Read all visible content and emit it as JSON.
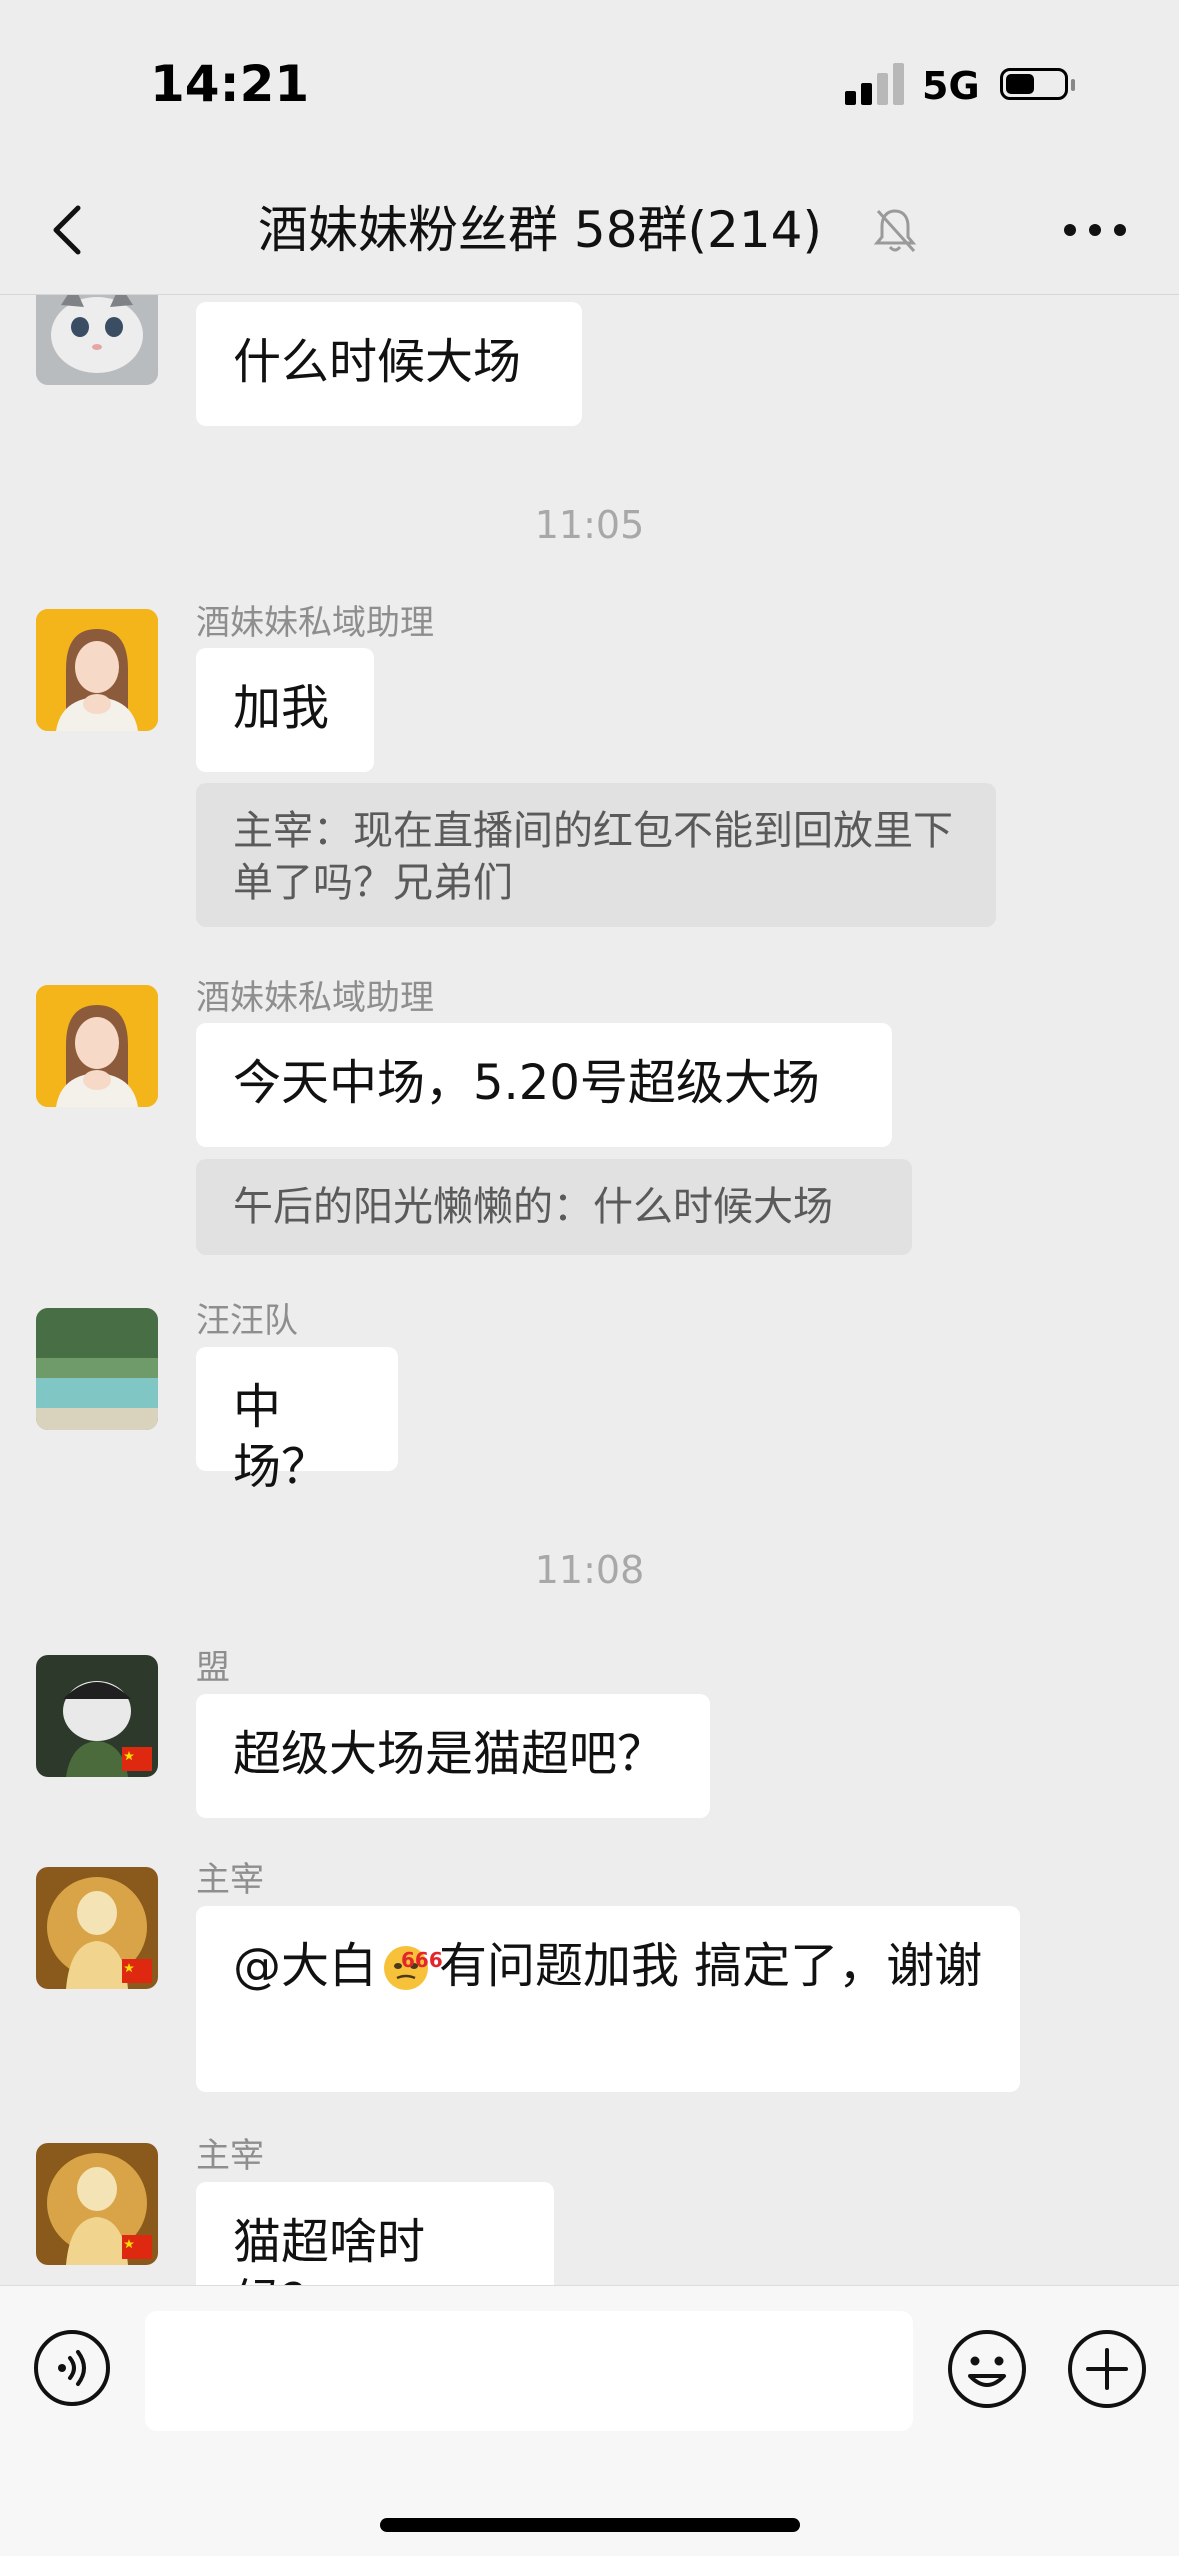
{
  "status_bar": {
    "time": "14:21",
    "network": "5G"
  },
  "nav": {
    "title": "酒妹妹粉丝群 58群(214)",
    "back_icon": "chevron-left-icon",
    "mute_icon": "bell-off-icon",
    "more_icon": "more-dots-icon"
  },
  "chat": {
    "msg0": {
      "text": "什么时候大场"
    },
    "time1": "11:05",
    "msg1": {
      "sender": "酒妹妹私域助理",
      "text": "加我",
      "quote": "主宰：现在直播间的红包不能到回放里下单了吗？兄弟们"
    },
    "msg2": {
      "sender": "酒妹妹私域助理",
      "text": "今天中场，5.20号超级大场",
      "quote": "午后的阳光懒懒的：什么时候大场"
    },
    "msg3": {
      "sender": "汪汪队",
      "text": "中场？"
    },
    "time2": "11:08",
    "msg4": {
      "sender": "盟",
      "text": "超级大场是猫超吧？"
    },
    "msg5": {
      "sender": "主宰",
      "mention": "@大白",
      "emoji_badge": "666",
      "text": "有问题加我 搞定了，谢谢"
    },
    "msg6": {
      "sender": "主宰",
      "text": "猫超啥时候？"
    }
  },
  "input_bar": {
    "value": "",
    "placeholder": "",
    "voice_icon": "voice-icon",
    "emoji_icon": "emoji-icon",
    "plus_icon": "plus-icon"
  }
}
